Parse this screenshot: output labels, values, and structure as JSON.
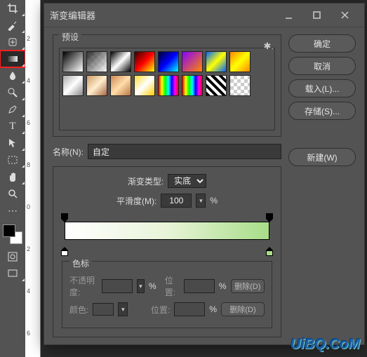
{
  "ruler": {
    "ticks": [
      "2",
      "4",
      "6",
      "8",
      "0",
      "2",
      "4",
      "6"
    ]
  },
  "dialog": {
    "title": "渐变编辑器",
    "presets_label": "预设",
    "buttons": {
      "ok": "确定",
      "cancel": "取消",
      "load": "载入(L)...",
      "save": "存储(S)...",
      "new": "新建(W)"
    },
    "name_label": "名称(N):",
    "name_value": "自定",
    "type_label": "渐变类型:",
    "type_value": "实底",
    "smooth_label": "平滑度(M):",
    "smooth_value": "100",
    "percent": "%",
    "stops_label": "色标",
    "opacity_label": "不透明度:",
    "pos_label": "位置:",
    "color_label": "颜色:",
    "delete_label": "删除(D)",
    "presets": [
      {
        "bg": "linear-gradient(135deg,#000,#fff)"
      },
      {
        "bg": "linear-gradient(135deg,#000,#fff)",
        "checker": true
      },
      {
        "bg": "linear-gradient(135deg,#000,#fff,#000)"
      },
      {
        "bg": "linear-gradient(135deg,#300,#f00,#ff0)"
      },
      {
        "bg": "linear-gradient(135deg,#003,#00f,#0ff)"
      },
      {
        "bg": "linear-gradient(135deg,#80f,#f80)"
      },
      {
        "bg": "linear-gradient(135deg,#06f,#ff0,#06f)"
      },
      {
        "bg": "linear-gradient(135deg,#f80,#ff0,#f80)"
      },
      {
        "bg": "linear-gradient(135deg,#aaa,#fff,#888)"
      },
      {
        "bg": "linear-gradient(135deg,#c96,#fec,#a64)"
      },
      {
        "bg": "linear-gradient(135deg,#c85,#fda,#b74)"
      },
      {
        "bg": "linear-gradient(135deg,#fd3,#fff,#fc0)"
      },
      {
        "bg": "linear-gradient(90deg,#f00,#ff0,#0f0,#0ff,#00f,#f0f,#f00)"
      },
      {
        "bg": "linear-gradient(90deg,#f00,#ff0,#0f0,#0ff,#00f,#f0f,#f00)"
      },
      {
        "bg": "repeating-linear-gradient(45deg,#000 0 4px,#fff 4px 8px)"
      },
      {
        "bg": "",
        "checker": true
      }
    ],
    "gradient_stops": {
      "opacity": [
        {
          "pos": 0,
          "color": "#000"
        },
        {
          "pos": 100,
          "color": "#000"
        }
      ],
      "color": [
        {
          "pos": 0,
          "color": "#fff"
        },
        {
          "pos": 100,
          "color": "#a8dd88"
        }
      ]
    }
  },
  "watermark": "UiBQ.CoM"
}
